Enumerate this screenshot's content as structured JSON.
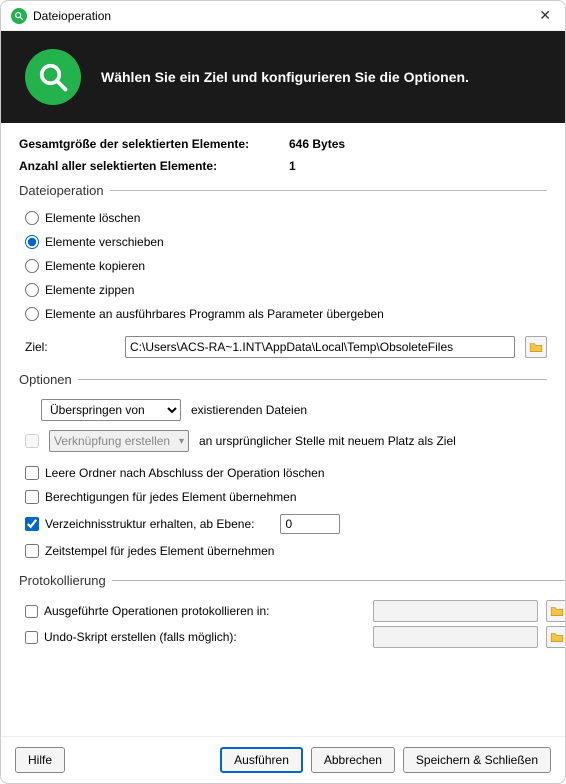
{
  "window": {
    "title": "Dateioperation",
    "headline": "Wählen Sie ein Ziel und konfigurieren Sie die Optionen."
  },
  "info": {
    "size_label": "Gesamtgröße der selektierten Elemente:",
    "size_value": "646 Bytes",
    "count_label": "Anzahl aller selektierten Elemente:",
    "count_value": "1"
  },
  "operation": {
    "legend": "Dateioperation",
    "delete": "Elemente löschen",
    "move": "Elemente verschieben",
    "copy": "Elemente kopieren",
    "zip": "Elemente zippen",
    "exec": "Elemente an ausführbares Programm als Parameter übergeben",
    "selected": "move",
    "target_label": "Ziel:",
    "target_value": "C:\\Users\\ACS-RA~1.INT\\AppData\\Local\\Temp\\ObsoleteFiles"
  },
  "options": {
    "legend": "Optionen",
    "skip_mode": "Überspringen von",
    "existing_suffix": "existierenden Dateien",
    "shortcut_label": "Verknüpfung erstellen",
    "shortcut_suffix": "an ursprünglicher Stelle mit neuem Platz als Ziel",
    "delete_empty": "Leere Ordner nach Abschluss der Operation löschen",
    "copy_perms": "Berechtigungen für jedes Element übernehmen",
    "keep_structure": "Verzeichnisstruktur erhalten, ab Ebene:",
    "keep_structure_checked": true,
    "level_value": "0",
    "copy_timestamps": "Zeitstempel für jedes Element übernehmen"
  },
  "logging": {
    "legend": "Protokollierung",
    "log_ops": "Ausgeführte Operationen protokollieren in:",
    "undo_script": "Undo-Skript erstellen (falls möglich):"
  },
  "footer": {
    "help": "Hilfe",
    "run": "Ausführen",
    "cancel": "Abbrechen",
    "save_close": "Speichern & Schließen"
  }
}
